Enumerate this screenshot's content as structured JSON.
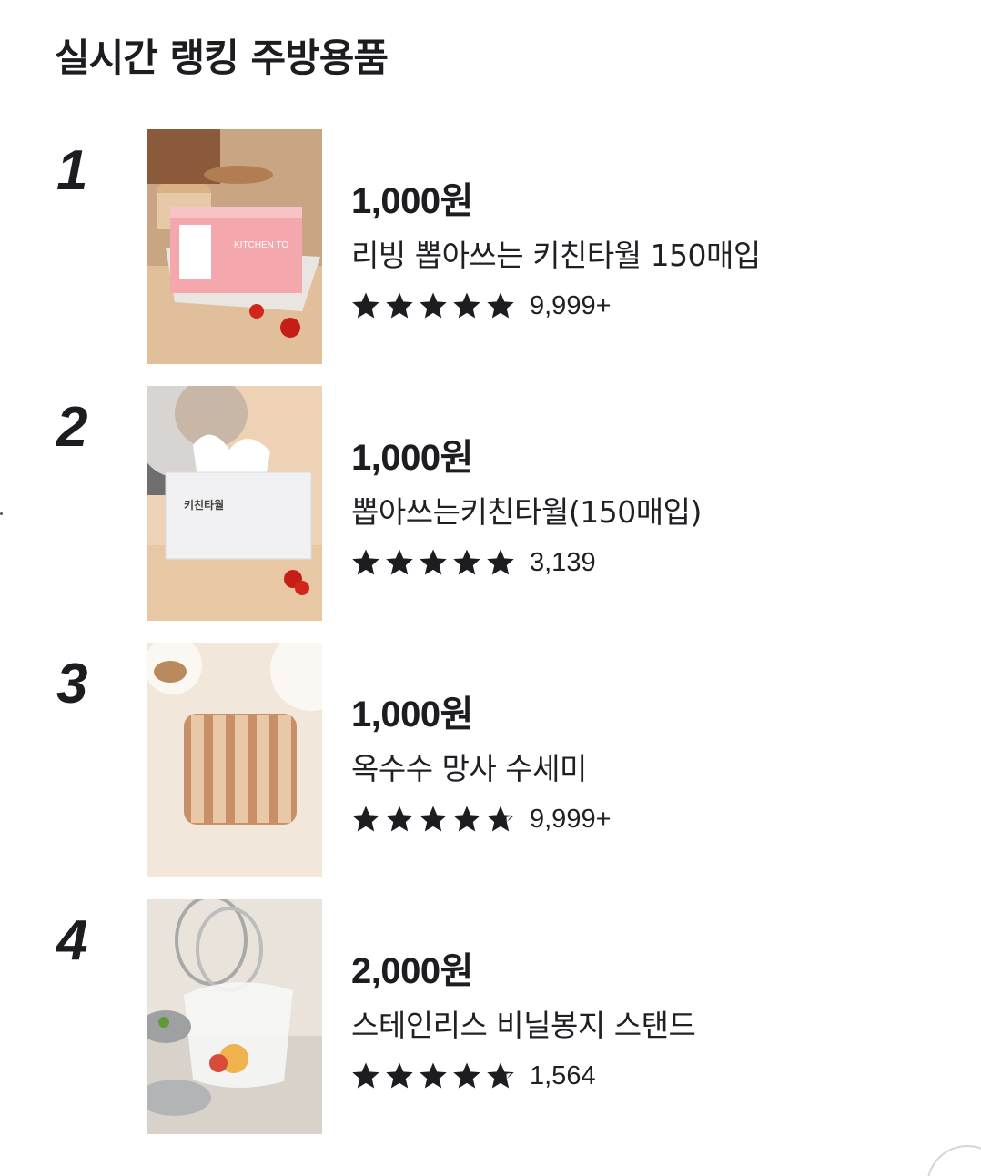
{
  "header": {
    "title": "실시간 랭킹 주방용품"
  },
  "items": [
    {
      "rank": "1",
      "price": "1,000원",
      "name": "리빙 뽑아쓰는 키친타월 150매입",
      "review_count": "9,999+",
      "rating": 5,
      "image": "kitchen-towel-box-pink-photo"
    },
    {
      "rank": "2",
      "price": "1,000원",
      "name": "뽑아쓰는키친타월(150매입)",
      "review_count": "3,139",
      "rating": 5,
      "image": "kitchen-towel-box-white-photo"
    },
    {
      "rank": "3",
      "price": "1,000원",
      "name": "옥수수 망사 수세미",
      "review_count": "9,999+",
      "rating": 4.5,
      "image": "mesh-scrubber-photo"
    },
    {
      "rank": "4",
      "price": "2,000원",
      "name": "스테인리스 비닐봉지 스탠드",
      "review_count": "1,564",
      "rating": 4.5,
      "image": "stainless-bag-stand-photo"
    }
  ],
  "colors": {
    "text": "#1c1d21",
    "star": "#1c1d21",
    "background": "#ffffff"
  }
}
